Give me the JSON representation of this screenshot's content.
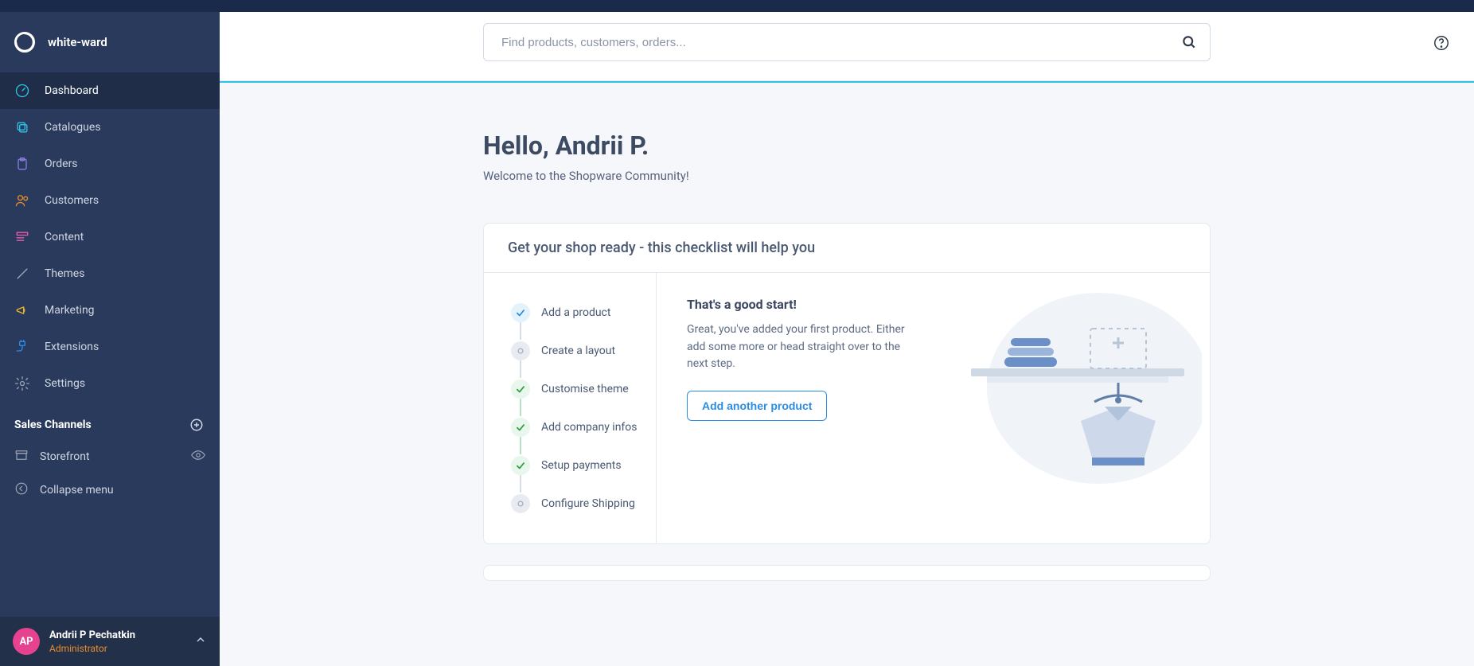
{
  "header": {
    "shop_name": "white-ward"
  },
  "sidebar": {
    "nav": [
      {
        "label": "Dashboard",
        "icon": "gauge",
        "color": "#2ec4e6",
        "active": true
      },
      {
        "label": "Catalogues",
        "icon": "copy",
        "color": "#2ec4e6",
        "active": false
      },
      {
        "label": "Orders",
        "icon": "clipboard",
        "color": "#8a7de2",
        "active": false
      },
      {
        "label": "Customers",
        "icon": "users",
        "color": "#e98c2a",
        "active": false
      },
      {
        "label": "Content",
        "icon": "layout",
        "color": "#e85ea8",
        "active": false
      },
      {
        "label": "Themes",
        "icon": "brush",
        "color": "#9aa3b3",
        "active": false
      },
      {
        "label": "Marketing",
        "icon": "megaphone",
        "color": "#e6b52a",
        "active": false
      },
      {
        "label": "Extensions",
        "icon": "plug",
        "color": "#2a8de4",
        "active": false
      },
      {
        "label": "Settings",
        "icon": "gear",
        "color": "#9aa3b3",
        "active": false
      }
    ],
    "sales_channels_header": "Sales Channels",
    "channels": [
      {
        "label": "Storefront"
      }
    ],
    "collapse_label": "Collapse menu"
  },
  "user": {
    "initials": "AP",
    "name": "Andrii P Pechatkin",
    "role": "Administrator"
  },
  "search": {
    "placeholder": "Find products, customers, orders..."
  },
  "dashboard": {
    "greeting_title": "Hello, Andrii P.",
    "greeting_sub": "Welcome to the Shopware Community!",
    "checklist_header": "Get your shop ready - this checklist will help you",
    "checklist": [
      {
        "label": "Add a product",
        "state": "active"
      },
      {
        "label": "Create a layout",
        "state": "pending"
      },
      {
        "label": "Customise theme",
        "state": "done"
      },
      {
        "label": "Add company infos",
        "state": "done"
      },
      {
        "label": "Setup payments",
        "state": "done"
      },
      {
        "label": "Configure Shipping",
        "state": "pending"
      }
    ],
    "detail": {
      "title": "That's a good start!",
      "text": "Great, you've added your first product. Either add some more or head straight over to the next step.",
      "cta": "Add another product"
    }
  }
}
